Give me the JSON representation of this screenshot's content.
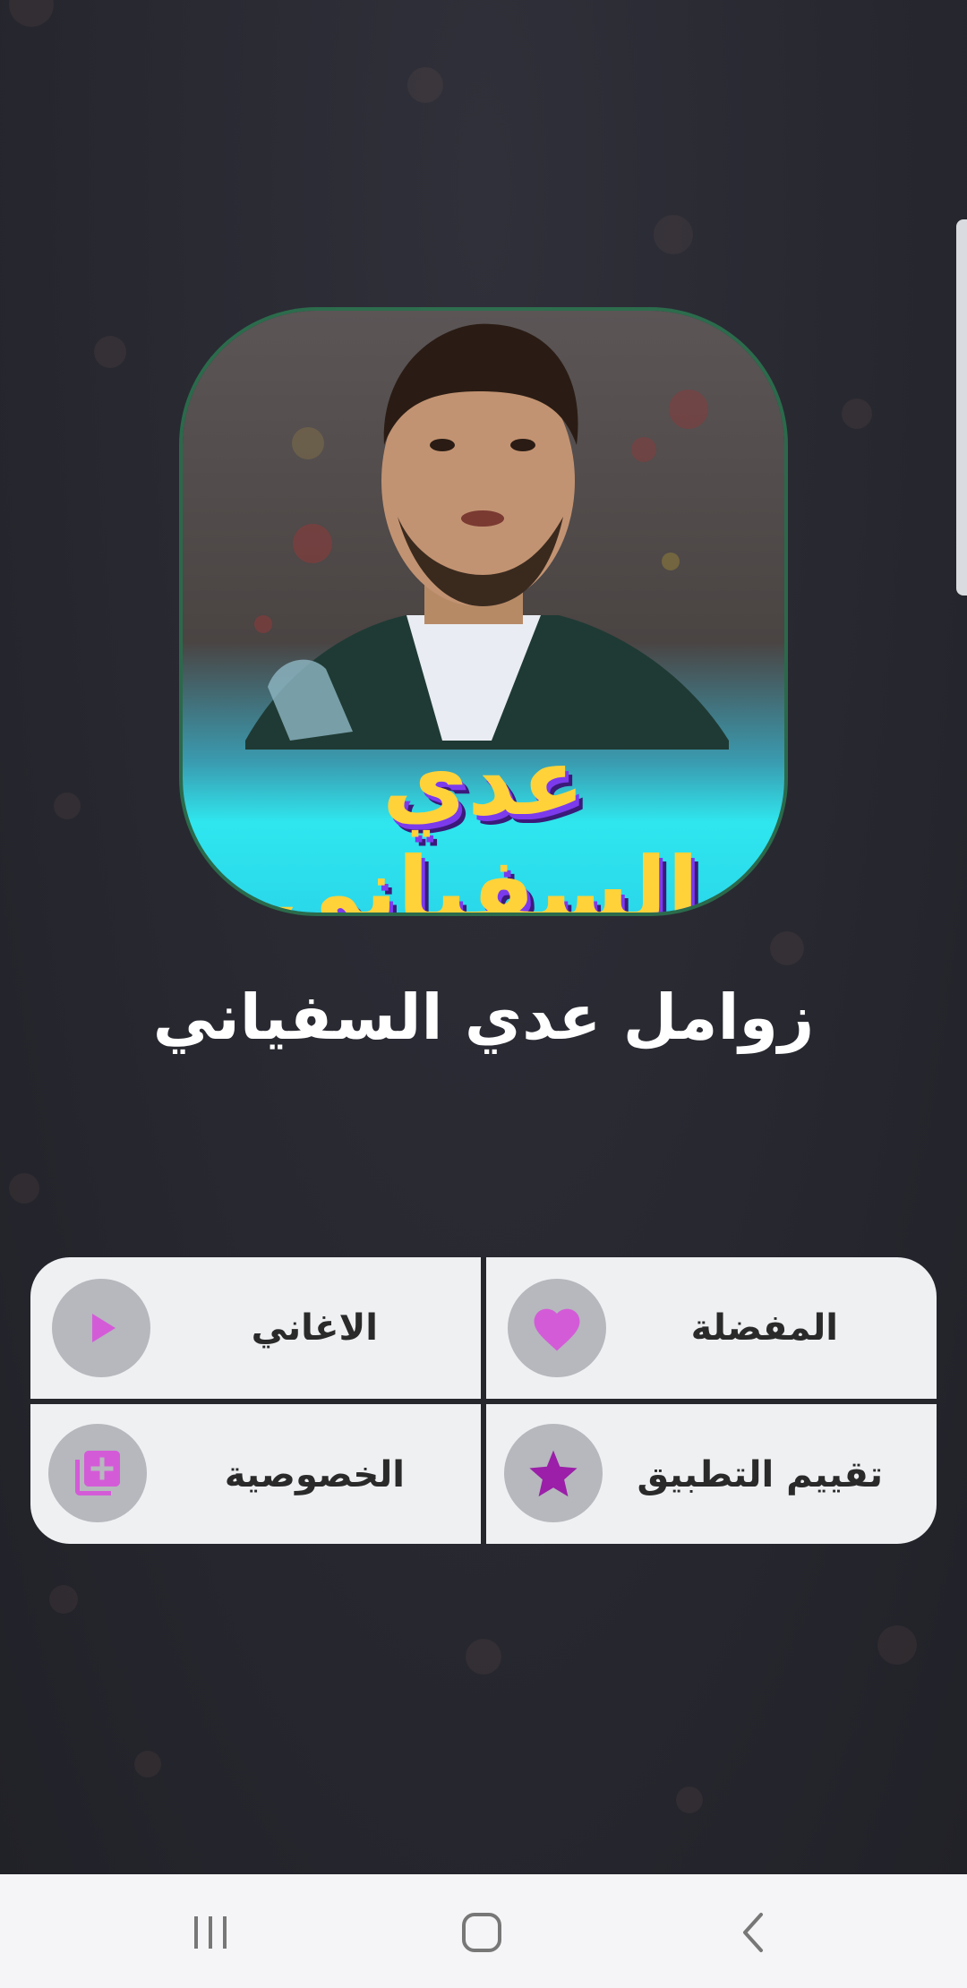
{
  "app": {
    "icon_caption": "عدي السفياني",
    "title": "زوامل عدي السفياني"
  },
  "menu": {
    "items": [
      {
        "label": "المفضلة",
        "icon": "heart-icon"
      },
      {
        "label": "الاغاني",
        "icon": "play-icon"
      },
      {
        "label": "تقييم التطبيق",
        "icon": "star-icon"
      },
      {
        "label": "الخصوصية",
        "icon": "library-add-icon"
      }
    ]
  },
  "navbar": {
    "buttons": [
      "recent-apps",
      "home",
      "back"
    ]
  },
  "colors": {
    "background": "#25252d",
    "menu_bg": "#eef0f2",
    "icon_circle": "#b6b8bd",
    "accent_pink": "#d45bd8",
    "accent_purple": "#9b1fa8"
  }
}
